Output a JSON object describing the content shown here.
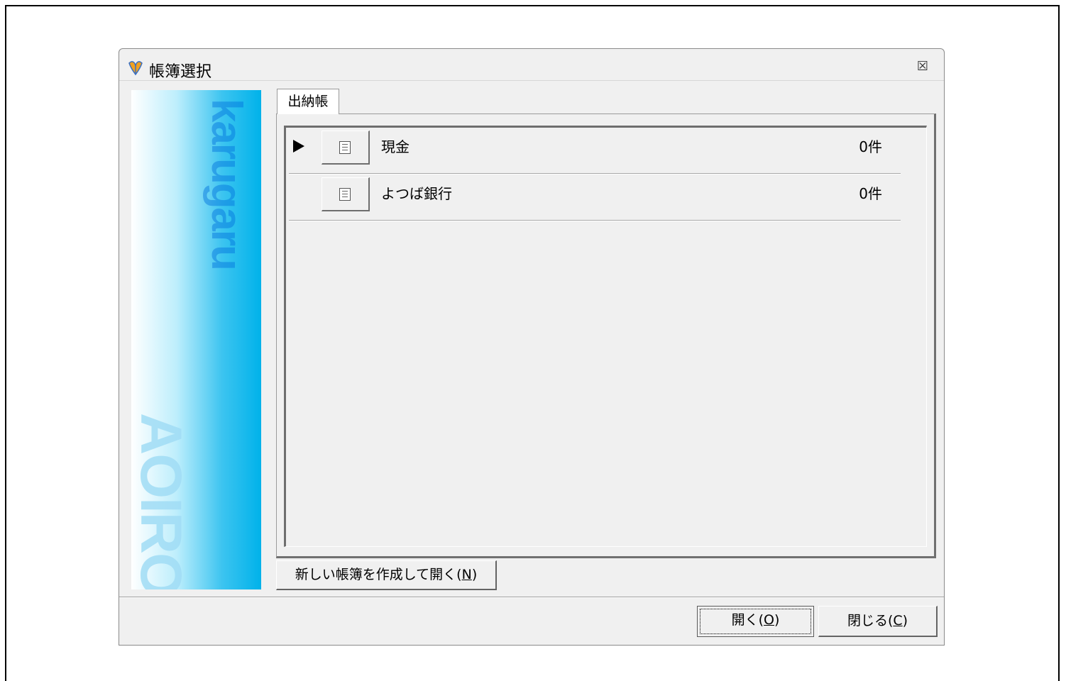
{
  "window": {
    "title": "帳簿選択",
    "close_glyph": "☒"
  },
  "banner": {
    "top_text": "karugaru",
    "bottom_text": "AOIRO"
  },
  "tabs": [
    {
      "label": "出納帳",
      "selected": true
    }
  ],
  "ledgers": [
    {
      "name": "現金",
      "count": "0件",
      "current": true
    },
    {
      "name": "よつば銀行",
      "count": "0件",
      "current": false
    }
  ],
  "buttons": {
    "new_ledger_prefix": "新しい帳簿を作成して開く(",
    "new_ledger_key": "N",
    "new_ledger_suffix": ")",
    "open_prefix": "開く(",
    "open_key": "O",
    "open_suffix": ")",
    "close_prefix": "閉じる(",
    "close_key": "C",
    "close_suffix": ")"
  },
  "colors": {
    "dialog_bg": "#f0f0f0",
    "banner_blue": "#00b2ea"
  }
}
